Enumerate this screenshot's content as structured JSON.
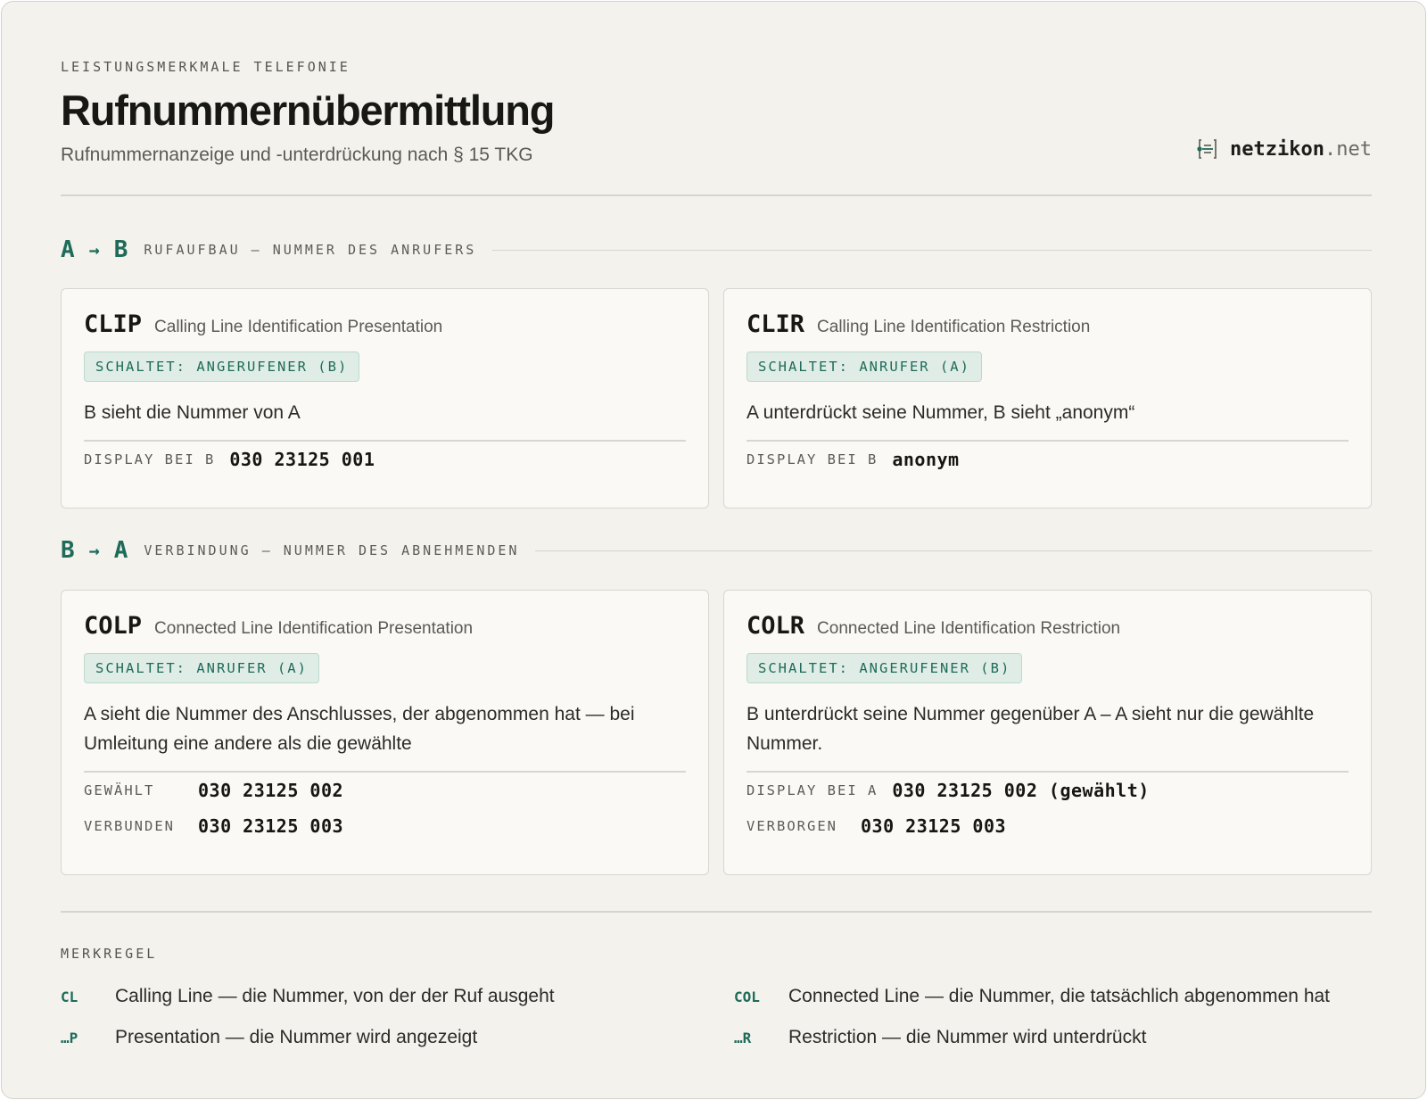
{
  "header": {
    "eyebrow": "LEISTUNGSMERKMALE TELEFONIE",
    "title": "Rufnummernübermittlung",
    "subtitle": "Rufnummernanzeige und -unterdrückung nach § 15 TKG",
    "brand_name": "netzikon",
    "brand_tld": ".net"
  },
  "sections": [
    {
      "from": "A",
      "arrow": "→",
      "to": "B",
      "label": "RUFAUFBAU — NUMMER DES ANRUFERS",
      "cards": [
        {
          "code": "CLIP",
          "long": "Calling Line Identification Presentation",
          "badge": "SCHALTET: ANGERUFENER (B)",
          "desc": "B sieht die Nummer von A",
          "rows": [
            {
              "key": "DISPLAY BEI B",
              "value": "030 23125 001"
            }
          ]
        },
        {
          "code": "CLIR",
          "long": "Calling Line Identification Restriction",
          "badge": "SCHALTET: ANRUFER (A)",
          "desc": "A unterdrückt seine Nummer, B sieht „anonym“",
          "rows": [
            {
              "key": "DISPLAY BEI B",
              "value": "anonym"
            }
          ]
        }
      ]
    },
    {
      "from": "B",
      "arrow": "→",
      "to": "A",
      "label": "VERBINDUNG — NUMMER DES ABNEHMENDEN",
      "cards": [
        {
          "code": "COLP",
          "long": "Connected Line Identification Presentation",
          "badge": "SCHALTET: ANRUFER (A)",
          "desc": "A sieht die Nummer des Anschlusses, der abgenommen hat — bei Umleitung eine andere als die gewählte",
          "rows": [
            {
              "key": "GEWÄHLT",
              "value": "030 23125 002"
            },
            {
              "key": "VERBUNDEN",
              "value": "030 23125 003"
            }
          ]
        },
        {
          "code": "COLR",
          "long": "Connected Line Identification Restriction",
          "badge": "SCHALTET: ANGERUFENER (B)",
          "desc": "B unterdrückt seine Nummer gegenüber A – A sieht nur die gewählte Nummer.",
          "rows": [
            {
              "key": "DISPLAY BEI A",
              "value": "030 23125 002 (gewählt)"
            },
            {
              "key": "VERBORGEN",
              "value": "030 23125 003"
            }
          ]
        }
      ]
    }
  ],
  "merkregel": {
    "title": "MERKREGEL",
    "items": [
      {
        "abbr": "CL",
        "text": "Calling Line — die Nummer, von der der Ruf ausgeht"
      },
      {
        "abbr": "COL",
        "text": "Connected Line — die Nummer, die tatsächlich abgenommen hat"
      },
      {
        "abbr": "…P",
        "text": "Presentation — die Nummer wird angezeigt"
      },
      {
        "abbr": "…R",
        "text": "Restriction — die Nummer wird unterdrückt"
      }
    ]
  },
  "colors": {
    "accent": "#1e6b5a",
    "background": "#f3f2ed",
    "card": "#faf9f5",
    "badge_bg": "#dfede6"
  },
  "icons": {
    "brand": "document-lines-icon"
  }
}
